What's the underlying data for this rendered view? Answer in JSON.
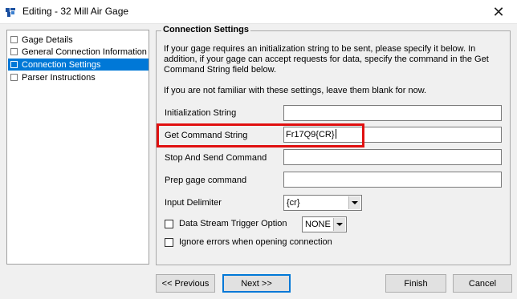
{
  "window": {
    "title": "Editing - 32 Mill Air Gage",
    "close_glyph": "✕"
  },
  "nav": {
    "items": [
      {
        "label": "Gage Details"
      },
      {
        "label": "General Connection Information"
      },
      {
        "label": "Connection Settings",
        "selected": true
      },
      {
        "label": "Parser Instructions"
      }
    ]
  },
  "panel": {
    "title": "Connection Settings",
    "description": "If your gage requires an initialization string to be sent, please specify it below. In addition, if your gage can accept requests for data, specify the command in the Get Command String field below.",
    "hint": "If you are not familiar with these settings, leave them blank for now.",
    "fields": {
      "initialization_string": {
        "label": "Initialization String",
        "value": ""
      },
      "get_command_string": {
        "label": "Get Command String",
        "value": "Fr17Q9{CR}"
      },
      "stop_and_send_command": {
        "label": "Stop And Send Command",
        "value": ""
      },
      "prep_gage_command": {
        "label": "Prep gage command",
        "value": ""
      }
    },
    "input_delimiter": {
      "label": "Input Delimiter",
      "value": "{cr}"
    },
    "data_stream_trigger": {
      "label": "Data Stream Trigger Option",
      "checked": false,
      "value": "NONE"
    },
    "ignore_errors": {
      "label": "Ignore errors when opening connection",
      "checked": false
    }
  },
  "buttons": {
    "previous": "<< Previous",
    "next": "Next >>",
    "finish": "Finish",
    "cancel": "Cancel"
  },
  "colors": {
    "selection": "#0078d7",
    "highlight": "#e01010"
  }
}
